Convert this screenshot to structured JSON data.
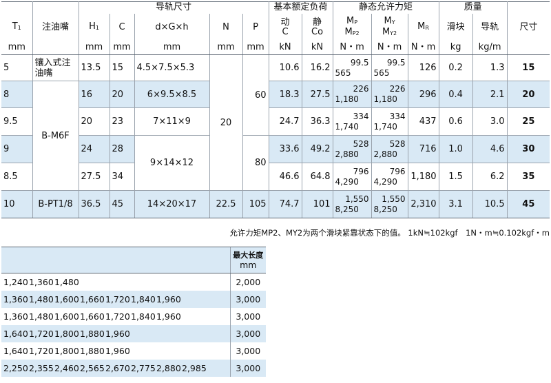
{
  "header": {
    "rail_dimensions": "导轨尺寸",
    "basic_rated_load": "基本额定负荷",
    "static_moment": "静态允许力矩",
    "mass": "质量",
    "t1": "T1",
    "grease_nipple": "注油嘴",
    "h1": "H1",
    "c": "C",
    "dgh": "d×G×h",
    "n": "N",
    "p": "P",
    "dynamic": "动",
    "static": "静",
    "dyn_sym": "C",
    "sta_sym": "Co",
    "mp_top": "MP",
    "mp_bottom": "MP2",
    "my_top": "MY",
    "my_bottom": "MY2",
    "mr": "MR",
    "block": "滑块",
    "rail": "导轨",
    "size": "尺寸",
    "mm": "mm",
    "kn": "kN",
    "nm": "N・m",
    "kg": "kg",
    "kgm": "kg/m"
  },
  "rows": [
    {
      "t1": "5",
      "nipple": "镶入式注油嘴",
      "h1": "13.5",
      "c": "15",
      "dgh": "4.5×7.5×5.3",
      "dyn": "10.6",
      "sta": "16.2",
      "mp1": "99.5",
      "mp2": "565",
      "my1": "99.5",
      "my2": "565",
      "mr": "126",
      "block": "0.2",
      "rail": "1.3",
      "size": "15"
    },
    {
      "t1": "8",
      "h1": "16",
      "c": "20",
      "dgh": "6×9.5×8.5",
      "dyn": "18.3",
      "sta": "27.5",
      "mp1": "226",
      "mp2": "1,180",
      "my1": "226",
      "my2": "1,180",
      "mr": "296",
      "block": "0.4",
      "rail": "2.1",
      "size": "20"
    },
    {
      "t1": "9.5",
      "h1": "20",
      "c": "23",
      "dgh": "7×11×9",
      "dyn": "24.7",
      "sta": "36.3",
      "mp1": "334",
      "mp2": "1,740",
      "my1": "334",
      "my2": "1,740",
      "mr": "437",
      "block": "0.6",
      "rail": "3.0",
      "size": "25"
    },
    {
      "t1": "9",
      "h1": "24",
      "c": "28",
      "dyn": "33.6",
      "sta": "49.2",
      "mp1": "528",
      "mp2": "2,880",
      "my1": "528",
      "my2": "2,880",
      "mr": "716",
      "block": "1.0",
      "rail": "4.6",
      "size": "30"
    },
    {
      "t1": "8.5",
      "h1": "27.5",
      "c": "34",
      "dyn": "46.6",
      "sta": "64.8",
      "mp1": "796",
      "mp2": "4,290",
      "my1": "796",
      "my2": "4,290",
      "mr": "1,180",
      "block": "1.5",
      "rail": "6.2",
      "size": "35"
    },
    {
      "t1": "10",
      "nipple": "B-PT1/8",
      "h1": "36.5",
      "c": "45",
      "dgh": "14×20×17",
      "n": "22.5",
      "p": "105",
      "dyn": "74.7",
      "sta": "101",
      "mp1": "1,550",
      "mp2": "8,250",
      "my1": "1,550",
      "my2": "8,250",
      "mr": "2,310",
      "block": "3.1",
      "rail": "10.5",
      "size": "45"
    }
  ],
  "merged": {
    "nipple_b_m6f": "B-M6F",
    "dgh_30_35": "9×14×12",
    "n_common": "20",
    "p_60": "60",
    "p_80": "80"
  },
  "note": "允许力矩MP2、MY2为两个滑块紧靠状态下的值。 1kN≒102kgf　1N・m≒0.102kgf・m",
  "length_table": {
    "header_top": "最大长度",
    "header_unit": "mm",
    "rows": [
      {
        "lengths": [
          "1,240",
          "1,360",
          "1,480",
          "",
          "",
          "",
          "",
          "",
          ""
        ],
        "max": "2,000"
      },
      {
        "lengths": [
          "1,360",
          "1,480",
          "1,600",
          "1,660",
          "1,720",
          "1,840",
          "1,960",
          "",
          ""
        ],
        "max": "3,000"
      },
      {
        "lengths": [
          "1,360",
          "1,480",
          "1,600",
          "1,660",
          "1,720",
          "1,840",
          "1,960",
          "",
          ""
        ],
        "max": "3,000"
      },
      {
        "lengths": [
          "1,640",
          "1,720",
          "1,800",
          "1,880",
          "1,960",
          "",
          "",
          "",
          ""
        ],
        "max": "3,000"
      },
      {
        "lengths": [
          "1,640",
          "1,720",
          "1,800",
          "1,880",
          "1,960",
          "",
          "",
          "",
          ""
        ],
        "max": "3,000"
      },
      {
        "lengths": [
          "2,250",
          "2,355",
          "2,460",
          "2,565",
          "2,670",
          "2,775",
          "2,880",
          "2,985",
          ""
        ],
        "max": "3,000"
      }
    ]
  },
  "colors": {
    "shade": "#d9e9f5",
    "rule": "#5a6470",
    "grid": "#9aa3ad"
  }
}
